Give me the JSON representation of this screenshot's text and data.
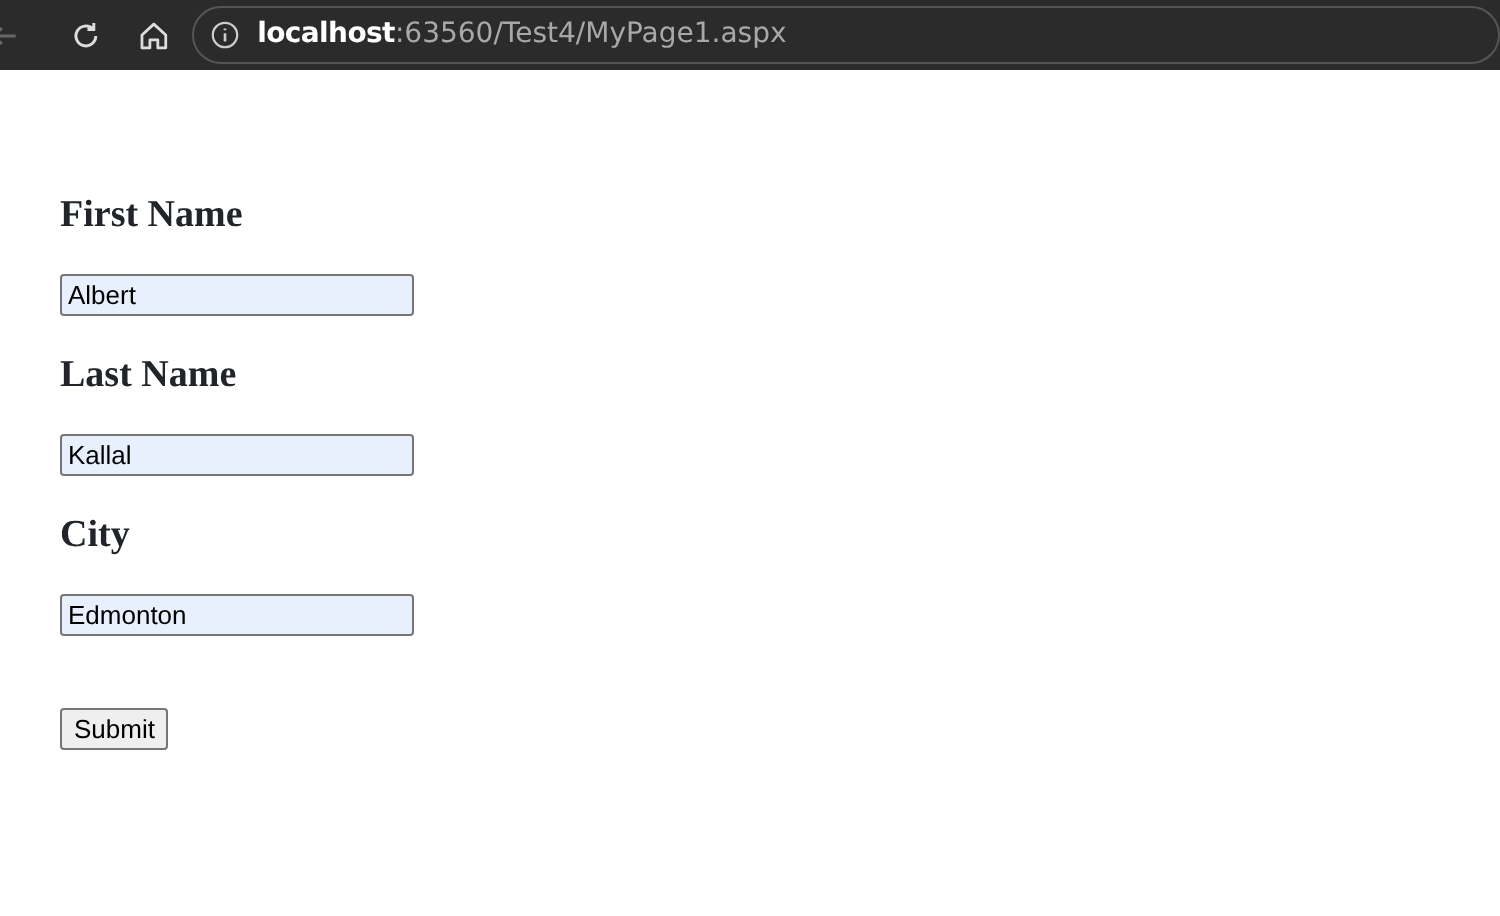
{
  "browser": {
    "url_host": "localhost",
    "url_path": ":63560/Test4/MyPage1.aspx"
  },
  "fields": [
    {
      "label": "First Name",
      "value": "Albert"
    },
    {
      "label": "Last Name",
      "value": "Kallal"
    },
    {
      "label": "City",
      "value": "Edmonton"
    }
  ],
  "submit_button": "Submit"
}
